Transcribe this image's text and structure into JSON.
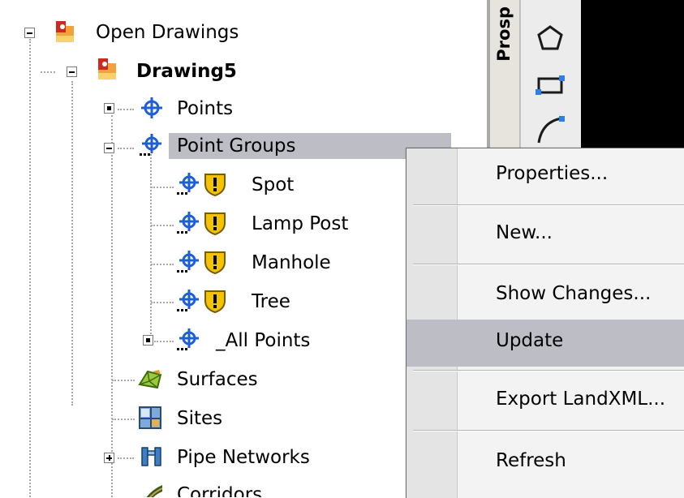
{
  "tree": {
    "root": {
      "label": "Open Drawings",
      "icon": "drawings-icon"
    },
    "drawing": {
      "label": "Drawing5",
      "icon": "drawing-icon"
    },
    "items": {
      "points": {
        "label": "Points",
        "icon": "point-icon"
      },
      "point_groups": {
        "label": "Point Groups",
        "icon": "point-group-icon"
      },
      "spot": {
        "label": "Spot",
        "icon": "warning-icon"
      },
      "lamp_post": {
        "label": "Lamp Post",
        "icon": "warning-icon"
      },
      "manhole": {
        "label": "Manhole",
        "icon": "warning-icon"
      },
      "tree": {
        "label": "Tree",
        "icon": "warning-icon"
      },
      "all_points": {
        "label": "_All Points",
        "icon": "point-group-icon"
      },
      "surfaces": {
        "label": "Surfaces",
        "icon": "surface-icon"
      },
      "sites": {
        "label": "Sites",
        "icon": "sites-icon"
      },
      "pipe_networks": {
        "label": "Pipe Networks",
        "icon": "pipe-network-icon"
      },
      "corridors": {
        "label": "Corridors",
        "icon": "corridor-icon"
      }
    }
  },
  "palette_tab": {
    "label": "Prosp"
  },
  "context_menu": {
    "items": [
      {
        "label": "Properties..."
      },
      {
        "label": "New..."
      },
      {
        "label": "Show Changes..."
      },
      {
        "label": "Update",
        "highlighted": true
      },
      {
        "label": "Export LandXML..."
      },
      {
        "label": "Refresh"
      }
    ]
  },
  "colors": {
    "selection": "#bdbdc6",
    "canvas": "#000000",
    "point_blue": "#1f5fd6",
    "warning_yellow": "#f2c400"
  }
}
